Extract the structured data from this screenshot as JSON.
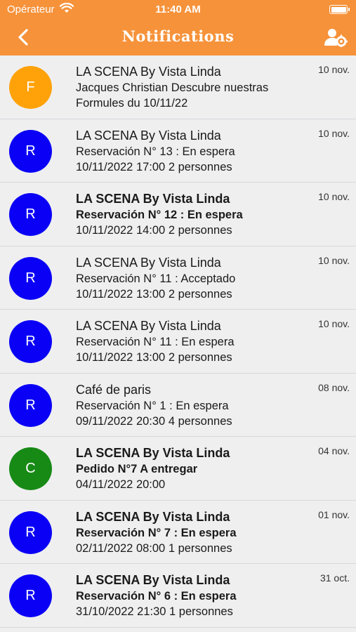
{
  "status_bar": {
    "carrier": "Opérateur",
    "time": "11:40 AM"
  },
  "nav": {
    "title": "Notifications",
    "back_icon": "chevron-left-icon",
    "settings_icon": "user-gear-icon"
  },
  "colors": {
    "accent": "#f6923a",
    "avatar_f": "#ffa20a",
    "avatar_r": "#0a00f5",
    "avatar_c": "#178a16"
  },
  "notifications": [
    {
      "initial": "F",
      "color": "#ffa20a",
      "bold": false,
      "title": "LA SCENA By Vista Linda",
      "line2": "Jacques Christian Descubre nuestras",
      "line3": "Formules du 10/11/22",
      "date": "10 nov."
    },
    {
      "initial": "R",
      "color": "#0a00f5",
      "bold": false,
      "title": "LA SCENA By Vista Linda",
      "line2": "Reservación N° 13 : En espera",
      "line3": "10/11/2022 17:00 2 personnes",
      "date": "10 nov."
    },
    {
      "initial": "R",
      "color": "#0a00f5",
      "bold": true,
      "title": "LA SCENA By Vista Linda",
      "line2": "Reservación N° 12 : En espera",
      "line3": "10/11/2022 14:00 2 personnes",
      "date": "10 nov."
    },
    {
      "initial": "R",
      "color": "#0a00f5",
      "bold": false,
      "title": "LA SCENA By Vista Linda",
      "line2": "Reservación N° 11 : Acceptado",
      "line3": "10/11/2022 13:00 2 personnes",
      "date": "10 nov."
    },
    {
      "initial": "R",
      "color": "#0a00f5",
      "bold": false,
      "title": "LA SCENA By Vista Linda",
      "line2": "Reservación N° 11 : En espera",
      "line3": "10/11/2022 13:00 2 personnes",
      "date": "10 nov."
    },
    {
      "initial": "R",
      "color": "#0a00f5",
      "bold": false,
      "title": "Café de paris",
      "line2": "Reservación N° 1 : En espera",
      "line3": "09/11/2022 20:30 4 personnes",
      "date": "08 nov."
    },
    {
      "initial": "C",
      "color": "#178a16",
      "bold": true,
      "title": "LA SCENA By Vista Linda",
      "line2": "Pedido N°7 A entregar",
      "line3": "04/11/2022 20:00",
      "date": "04 nov."
    },
    {
      "initial": "R",
      "color": "#0a00f5",
      "bold": true,
      "title": "LA SCENA By Vista Linda",
      "line2": "Reservación N° 7 : En espera",
      "line3": "02/11/2022 08:00 1 personnes",
      "date": "01 nov."
    },
    {
      "initial": "R",
      "color": "#0a00f5",
      "bold": true,
      "title": "LA SCENA By Vista Linda",
      "line2": "Reservación N° 6 : En espera",
      "line3": "31/10/2022 21:30 1 personnes",
      "date": "31 oct."
    }
  ]
}
